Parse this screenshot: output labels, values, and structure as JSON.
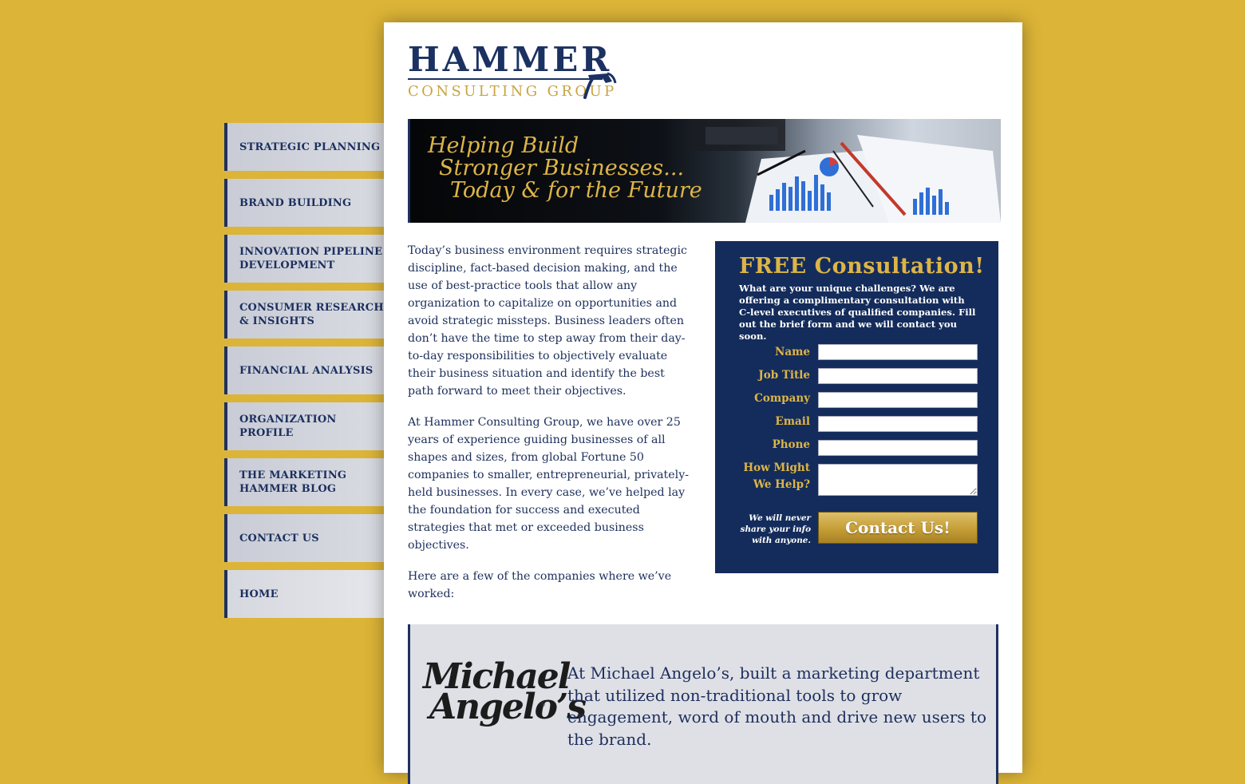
{
  "nav": {
    "items": [
      {
        "label": "STRATEGIC PLANNING"
      },
      {
        "label": "BRAND BUILDING"
      },
      {
        "label": "INNOVATION PIPELINE\nDEVELOPMENT"
      },
      {
        "label": "CONSUMER RESEARCH\n& INSIGHTS"
      },
      {
        "label": "FINANCIAL ANALYSIS"
      },
      {
        "label": "ORGANIZATION\nPROFILE"
      },
      {
        "label": "THE MARKETING\nHAMMER BLOG"
      },
      {
        "label": "CONTACT US"
      },
      {
        "label": "HOME"
      }
    ]
  },
  "logo": {
    "name": "HAMMER",
    "subtitle": "CONSULTING GROUP",
    "icon": "hammer-icon"
  },
  "banner": {
    "line1": "Helping Build",
    "line2": "Stronger Businesses...",
    "line3": "Today & for the Future"
  },
  "body": {
    "p1": "Today’s business environment requires strategic discipline, fact-based decision making, and the use of best-practice tools that allow any organization to capitalize on opportunities and avoid strategic missteps. Business leaders often don’t have the time to step away from their day-to-day responsibilities to objectively evaluate their business situation and identify the best path forward to meet their objectives.",
    "p2": "At Hammer Consulting Group, we have over 25 years of experience guiding businesses of all shapes and sizes, from global Fortune 50 companies to smaller, entrepreneurial, privately-held businesses. In every case, we’ve helped lay the foundation for success and executed strategies that met or exceeded business objectives.",
    "p3": "Here are a few of the companies where we’ve worked:"
  },
  "form": {
    "title": "FREE Consultation!",
    "description": "What are your unique challenges? We are offering a complimentary consultation with C-level executives of qualified companies. Fill out the brief form and we will contact you soon.",
    "fields": {
      "name": {
        "label": "Name",
        "value": ""
      },
      "job_title": {
        "label": "Job Title",
        "value": ""
      },
      "company": {
        "label": "Company",
        "value": ""
      },
      "email": {
        "label": "Email",
        "value": ""
      },
      "phone": {
        "label": "Phone",
        "value": ""
      },
      "help": {
        "label": "How Might\nWe Help?",
        "value": ""
      }
    },
    "privacy": "We will never share your info with anyone.",
    "submit_label": "Contact Us!"
  },
  "testimonial": {
    "client_line1": "Michael",
    "client_line2": "Angelo’s",
    "client_mark": "®",
    "quote": "At Michael Angelo’s, built a marketing department that utilized non-traditional tools to grow engagement, word of mouth and drive new users to the brand."
  },
  "colors": {
    "background": "#dcb437",
    "navy": "#142c5b",
    "gold": "#ddb547"
  }
}
